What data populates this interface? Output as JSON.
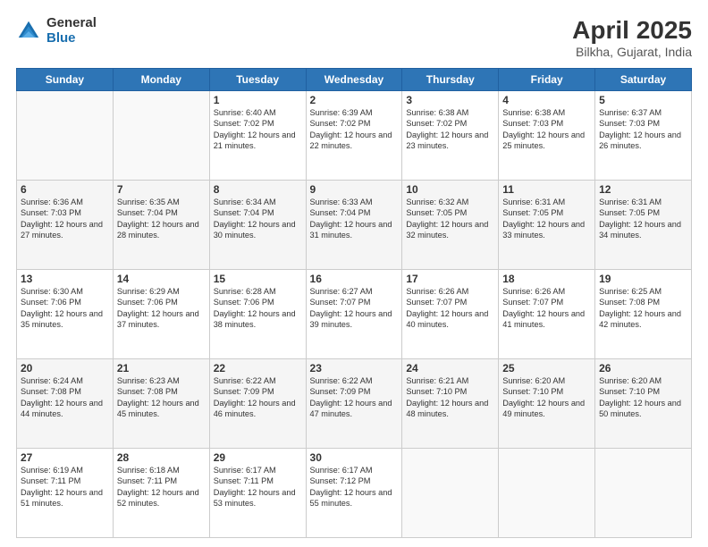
{
  "logo": {
    "general": "General",
    "blue": "Blue"
  },
  "title": "April 2025",
  "subtitle": "Bilkha, Gujarat, India",
  "days_of_week": [
    "Sunday",
    "Monday",
    "Tuesday",
    "Wednesday",
    "Thursday",
    "Friday",
    "Saturday"
  ],
  "weeks": [
    [
      {
        "day": "",
        "info": ""
      },
      {
        "day": "",
        "info": ""
      },
      {
        "day": "1",
        "info": "Sunrise: 6:40 AM\nSunset: 7:02 PM\nDaylight: 12 hours and 21 minutes."
      },
      {
        "day": "2",
        "info": "Sunrise: 6:39 AM\nSunset: 7:02 PM\nDaylight: 12 hours and 22 minutes."
      },
      {
        "day": "3",
        "info": "Sunrise: 6:38 AM\nSunset: 7:02 PM\nDaylight: 12 hours and 23 minutes."
      },
      {
        "day": "4",
        "info": "Sunrise: 6:38 AM\nSunset: 7:03 PM\nDaylight: 12 hours and 25 minutes."
      },
      {
        "day": "5",
        "info": "Sunrise: 6:37 AM\nSunset: 7:03 PM\nDaylight: 12 hours and 26 minutes."
      }
    ],
    [
      {
        "day": "6",
        "info": "Sunrise: 6:36 AM\nSunset: 7:03 PM\nDaylight: 12 hours and 27 minutes."
      },
      {
        "day": "7",
        "info": "Sunrise: 6:35 AM\nSunset: 7:04 PM\nDaylight: 12 hours and 28 minutes."
      },
      {
        "day": "8",
        "info": "Sunrise: 6:34 AM\nSunset: 7:04 PM\nDaylight: 12 hours and 30 minutes."
      },
      {
        "day": "9",
        "info": "Sunrise: 6:33 AM\nSunset: 7:04 PM\nDaylight: 12 hours and 31 minutes."
      },
      {
        "day": "10",
        "info": "Sunrise: 6:32 AM\nSunset: 7:05 PM\nDaylight: 12 hours and 32 minutes."
      },
      {
        "day": "11",
        "info": "Sunrise: 6:31 AM\nSunset: 7:05 PM\nDaylight: 12 hours and 33 minutes."
      },
      {
        "day": "12",
        "info": "Sunrise: 6:31 AM\nSunset: 7:05 PM\nDaylight: 12 hours and 34 minutes."
      }
    ],
    [
      {
        "day": "13",
        "info": "Sunrise: 6:30 AM\nSunset: 7:06 PM\nDaylight: 12 hours and 35 minutes."
      },
      {
        "day": "14",
        "info": "Sunrise: 6:29 AM\nSunset: 7:06 PM\nDaylight: 12 hours and 37 minutes."
      },
      {
        "day": "15",
        "info": "Sunrise: 6:28 AM\nSunset: 7:06 PM\nDaylight: 12 hours and 38 minutes."
      },
      {
        "day": "16",
        "info": "Sunrise: 6:27 AM\nSunset: 7:07 PM\nDaylight: 12 hours and 39 minutes."
      },
      {
        "day": "17",
        "info": "Sunrise: 6:26 AM\nSunset: 7:07 PM\nDaylight: 12 hours and 40 minutes."
      },
      {
        "day": "18",
        "info": "Sunrise: 6:26 AM\nSunset: 7:07 PM\nDaylight: 12 hours and 41 minutes."
      },
      {
        "day": "19",
        "info": "Sunrise: 6:25 AM\nSunset: 7:08 PM\nDaylight: 12 hours and 42 minutes."
      }
    ],
    [
      {
        "day": "20",
        "info": "Sunrise: 6:24 AM\nSunset: 7:08 PM\nDaylight: 12 hours and 44 minutes."
      },
      {
        "day": "21",
        "info": "Sunrise: 6:23 AM\nSunset: 7:08 PM\nDaylight: 12 hours and 45 minutes."
      },
      {
        "day": "22",
        "info": "Sunrise: 6:22 AM\nSunset: 7:09 PM\nDaylight: 12 hours and 46 minutes."
      },
      {
        "day": "23",
        "info": "Sunrise: 6:22 AM\nSunset: 7:09 PM\nDaylight: 12 hours and 47 minutes."
      },
      {
        "day": "24",
        "info": "Sunrise: 6:21 AM\nSunset: 7:10 PM\nDaylight: 12 hours and 48 minutes."
      },
      {
        "day": "25",
        "info": "Sunrise: 6:20 AM\nSunset: 7:10 PM\nDaylight: 12 hours and 49 minutes."
      },
      {
        "day": "26",
        "info": "Sunrise: 6:20 AM\nSunset: 7:10 PM\nDaylight: 12 hours and 50 minutes."
      }
    ],
    [
      {
        "day": "27",
        "info": "Sunrise: 6:19 AM\nSunset: 7:11 PM\nDaylight: 12 hours and 51 minutes."
      },
      {
        "day": "28",
        "info": "Sunrise: 6:18 AM\nSunset: 7:11 PM\nDaylight: 12 hours and 52 minutes."
      },
      {
        "day": "29",
        "info": "Sunrise: 6:17 AM\nSunset: 7:11 PM\nDaylight: 12 hours and 53 minutes."
      },
      {
        "day": "30",
        "info": "Sunrise: 6:17 AM\nSunset: 7:12 PM\nDaylight: 12 hours and 55 minutes."
      },
      {
        "day": "",
        "info": ""
      },
      {
        "day": "",
        "info": ""
      },
      {
        "day": "",
        "info": ""
      }
    ]
  ]
}
